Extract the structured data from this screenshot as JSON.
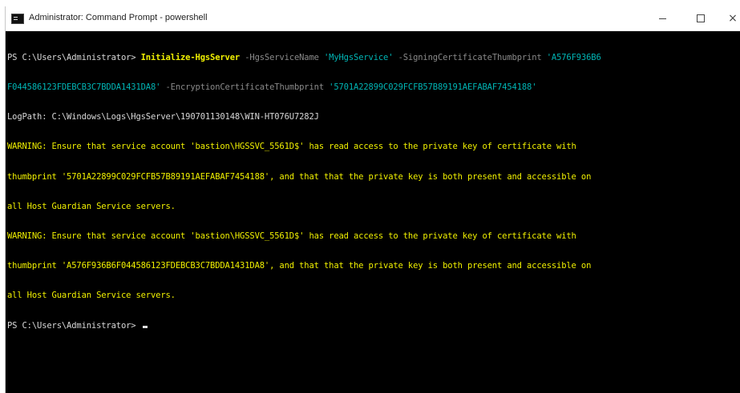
{
  "window": {
    "title": "Administrator: Command Prompt - powershell",
    "controls": {
      "minimize": "–",
      "maximize": "☐",
      "close": "×"
    }
  },
  "console": {
    "command": {
      "prompt": "PS C:\\Users\\Administrator> ",
      "cmdlet": "Initialize-HgsServer",
      "p1": " -HgsServiceName ",
      "v1": "'MyHgsService'",
      "p2": " -SigningCertificateThumbprint ",
      "v2a": "'A576F936B6",
      "v2b": "F044586123FDEBCB3C7BDDA1431DA8'",
      "p3": " -EncryptionCertificateThumbprint ",
      "v3": "'5701A22899C029FCFB57B89191AEFABAF7454188'"
    },
    "logpath": "LogPath: C:\\Windows\\Logs\\HgsServer\\190701130148\\WIN-HT076U7282J",
    "warnings": [
      "WARNING: Ensure that service account 'bastion\\HGSSVC_5561D$' has read access to the private key of certificate with",
      "thumbprint '5701A22899C029FCFB57B89191AEFABAF7454188', and that that the private key is both present and accessible on",
      "all Host Guardian Service servers.",
      "WARNING: Ensure that service account 'bastion\\HGSSVC_5561D$' has read access to the private key of certificate with",
      "thumbprint 'A576F936B6F044586123FDEBCB3C7BDDA1431DA8', and that that the private key is both present and accessible on",
      "all Host Guardian Service servers."
    ],
    "final_prompt": "PS C:\\Users\\Administrator> "
  }
}
